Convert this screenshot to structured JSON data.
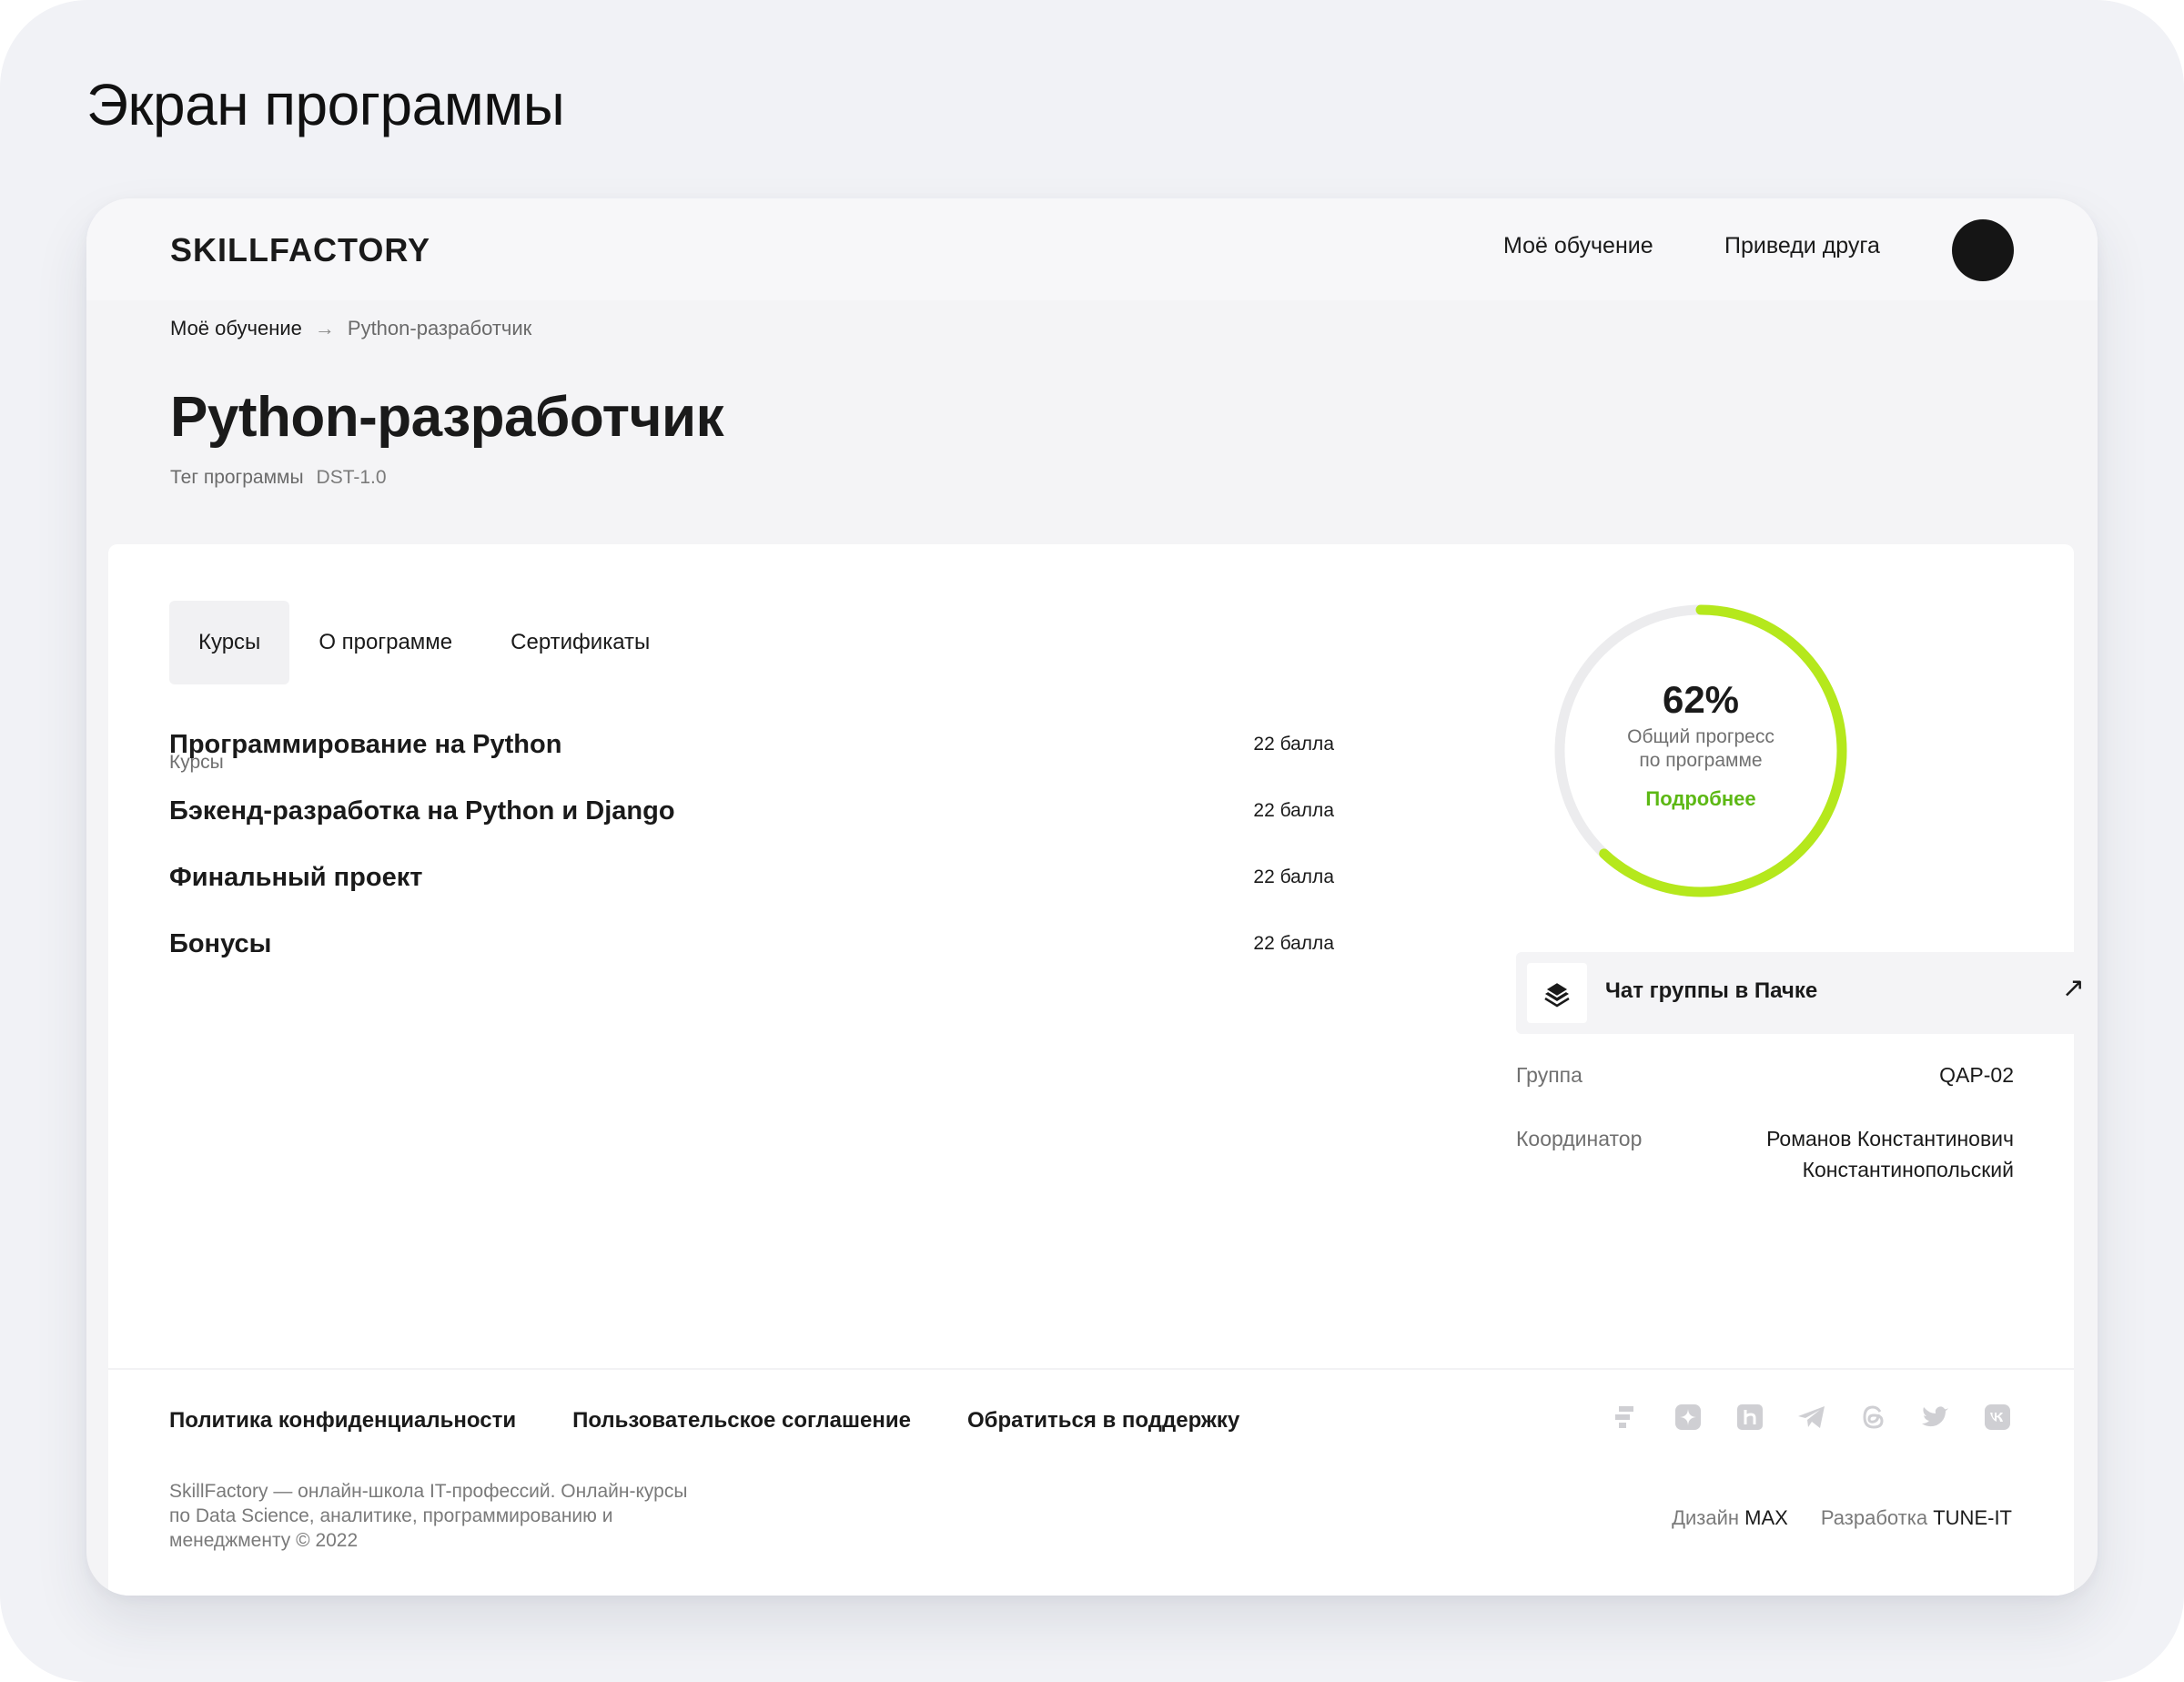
{
  "screen_title": "Экран программы",
  "header": {
    "logo": "SKILLFACTORY",
    "nav": [
      "Моё обучение",
      "Приведи друга"
    ]
  },
  "breadcrumb": {
    "parent": "Моё обучение",
    "arrow": "→",
    "current": "Python-разработчик"
  },
  "program": {
    "title": "Python-разработчик",
    "tag_label": "Тег программы",
    "tag_value": "DST-1.0"
  },
  "tabs": [
    "Курсы",
    "О программе",
    "Сертификаты"
  ],
  "active_tab": "Курсы",
  "courses_section_label": "Курсы",
  "courses": [
    {
      "name": "Программирование на Python",
      "score": "22 балла"
    },
    {
      "name": "Бэкенд-разработка на Python и Django",
      "score": "22 балла"
    },
    {
      "name": "Финальный проект",
      "score": "22 балла"
    },
    {
      "name": "Бонусы",
      "score": "22 балла"
    }
  ],
  "progress": {
    "value_text": "62%",
    "fraction": 0.62,
    "caption_line1": "Общий прогресс",
    "caption_line2": "по программе",
    "more_link": "Подробнее",
    "track_color": "#ececee",
    "fill_color": "#b5e81c",
    "link_color": "#5cb814"
  },
  "chat": {
    "label": "Чат группы в Пачке",
    "icon": "pachka-logo-icon",
    "arrow": "↗"
  },
  "group": {
    "label": "Группа",
    "value": "QAP-02"
  },
  "coordinator": {
    "label": "Координатор",
    "value_line1": "Романов Константинович",
    "value_line2": "Константинопольский"
  },
  "footer": {
    "links": [
      "Политика конфиденциальности",
      "Пользовательское соглашение",
      "Обратиться в поддержку"
    ],
    "desc_line1": "SkillFactory — онлайн-школа IT-профессий. Онлайн-курсы",
    "desc_line2": "по Data Science, аналитике, программированию и",
    "desc_line3": "менеджменту © 2022",
    "socials": [
      "skillfactory-icon",
      "yandex-zen-icon",
      "habr-icon",
      "telegram-icon",
      "threads-icon",
      "twitter-icon",
      "vk-icon"
    ],
    "design_label": "Дизайн",
    "design_name": "MAX",
    "dev_label": "Разработка",
    "dev_name": "TUNE-IT"
  }
}
